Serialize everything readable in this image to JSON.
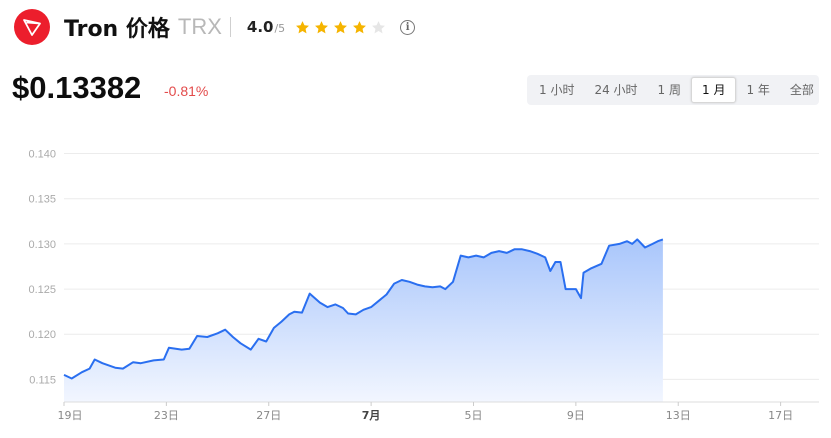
{
  "header": {
    "name": "Tron 价格",
    "symbol": "TRX",
    "rating": "4.0",
    "rating_max": "/5",
    "stars_filled": 4,
    "stars_total": 5,
    "logo_color": "#ec1e2c",
    "star_color": "#f5b400"
  },
  "price": {
    "value": "$0.13382",
    "change": "-0.81%",
    "change_color": "#e34b4b"
  },
  "tabs": [
    {
      "label": "1 小时",
      "active": false
    },
    {
      "label": "24 小时",
      "active": false
    },
    {
      "label": "1 周",
      "active": false
    },
    {
      "label": "1 月",
      "active": true
    },
    {
      "label": "1 年",
      "active": false
    },
    {
      "label": "全部",
      "active": false
    }
  ],
  "chart_data": {
    "type": "area",
    "ylim": [
      0.1125,
      0.1415
    ],
    "yticks": [
      0.14,
      0.135,
      0.13,
      0.125,
      0.12,
      0.115
    ],
    "ytick_labels": [
      "0.140",
      "0.135",
      "0.130",
      "0.125",
      "0.120",
      "0.115"
    ],
    "xlim": [
      0,
      29.5
    ],
    "xticks": [
      {
        "x": 0,
        "label": "19日"
      },
      {
        "x": 4,
        "label": "23日"
      },
      {
        "x": 8,
        "label": "27日"
      },
      {
        "x": 12,
        "label": "7月",
        "bold": true
      },
      {
        "x": 16,
        "label": "5日"
      },
      {
        "x": 20,
        "label": "9日"
      },
      {
        "x": 24,
        "label": "13日"
      },
      {
        "x": 28,
        "label": "17日"
      }
    ],
    "line_color": "#2a6ff0",
    "fill_top": "#a9c6fb",
    "fill_bottom": "#f2f6ff",
    "grid": true,
    "series": [
      {
        "points": [
          [
            0.0,
            0.1155
          ],
          [
            0.3,
            0.1151
          ],
          [
            0.7,
            0.1158
          ],
          [
            1.0,
            0.1162
          ],
          [
            1.2,
            0.1172
          ],
          [
            1.5,
            0.1168
          ],
          [
            2.0,
            0.1163
          ],
          [
            2.3,
            0.1162
          ],
          [
            2.7,
            0.1169
          ],
          [
            3.0,
            0.1168
          ],
          [
            3.5,
            0.1171
          ],
          [
            3.9,
            0.1172
          ],
          [
            4.1,
            0.1185
          ],
          [
            4.6,
            0.1183
          ],
          [
            4.9,
            0.1184
          ],
          [
            5.2,
            0.1198
          ],
          [
            5.6,
            0.1197
          ],
          [
            6.0,
            0.1201
          ],
          [
            6.3,
            0.1205
          ],
          [
            6.6,
            0.1197
          ],
          [
            6.9,
            0.119
          ],
          [
            7.3,
            0.1183
          ],
          [
            7.6,
            0.1195
          ],
          [
            7.9,
            0.1192
          ],
          [
            8.2,
            0.1207
          ],
          [
            8.5,
            0.1214
          ],
          [
            8.8,
            0.1222
          ],
          [
            9.0,
            0.1225
          ],
          [
            9.3,
            0.1224
          ],
          [
            9.6,
            0.1245
          ],
          [
            10.0,
            0.1235
          ],
          [
            10.3,
            0.123
          ],
          [
            10.6,
            0.1233
          ],
          [
            10.9,
            0.1229
          ],
          [
            11.1,
            0.1223
          ],
          [
            11.4,
            0.1222
          ],
          [
            11.7,
            0.1227
          ],
          [
            12.0,
            0.123
          ],
          [
            12.3,
            0.1237
          ],
          [
            12.6,
            0.1244
          ],
          [
            12.9,
            0.1256
          ],
          [
            13.2,
            0.126
          ],
          [
            13.5,
            0.1258
          ],
          [
            13.8,
            0.1255
          ],
          [
            14.1,
            0.1253
          ],
          [
            14.4,
            0.1252
          ],
          [
            14.7,
            0.1253
          ],
          [
            14.9,
            0.125
          ],
          [
            15.2,
            0.1258
          ],
          [
            15.5,
            0.1287
          ],
          [
            15.8,
            0.1285
          ],
          [
            16.1,
            0.1287
          ],
          [
            16.4,
            0.1285
          ],
          [
            16.7,
            0.129
          ],
          [
            17.0,
            0.1292
          ],
          [
            17.3,
            0.129
          ],
          [
            17.6,
            0.1294
          ],
          [
            17.9,
            0.1294
          ],
          [
            18.2,
            0.1292
          ],
          [
            18.5,
            0.1289
          ],
          [
            18.8,
            0.1285
          ],
          [
            19.0,
            0.127
          ],
          [
            19.2,
            0.128
          ],
          [
            19.4,
            0.128
          ],
          [
            19.6,
            0.125
          ],
          [
            19.8,
            0.125
          ],
          [
            20.0,
            0.125
          ],
          [
            20.2,
            0.124
          ],
          [
            20.3,
            0.1268
          ],
          [
            20.6,
            0.1273
          ],
          [
            21.0,
            0.1278
          ],
          [
            21.3,
            0.1298
          ],
          [
            21.7,
            0.13
          ],
          [
            22.0,
            0.1303
          ],
          [
            22.2,
            0.13
          ],
          [
            22.4,
            0.1305
          ],
          [
            22.7,
            0.1296
          ],
          [
            23.0,
            0.13
          ],
          [
            23.2,
            0.1303
          ],
          [
            23.4,
            0.1305
          ]
        ]
      }
    ]
  }
}
